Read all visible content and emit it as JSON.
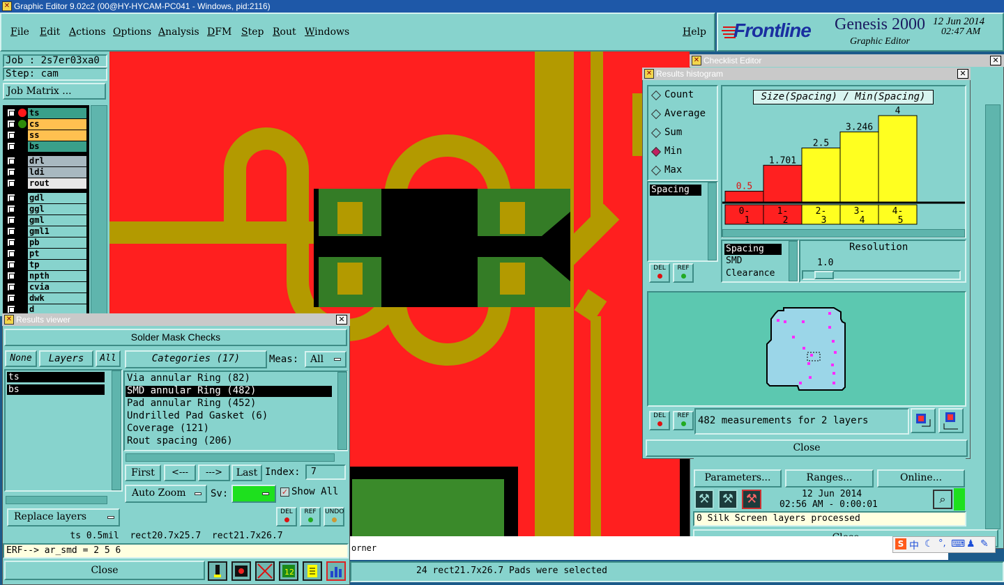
{
  "main_window": {
    "title": "Graphic Editor 9.02c2 (00@HY-HYCAM-PC041 - Windows, pid:2116)",
    "menu": [
      "File",
      "Edit",
      "Actions",
      "Options",
      "Analysis",
      "DFM",
      "Step",
      "Rout",
      "Windows"
    ],
    "help": "Help",
    "brand": "Frontline",
    "product": "Genesis 2000",
    "subtitle": "Graphic Editor",
    "date": "12 Jun 2014",
    "time": "02:47 AM"
  },
  "left_panel": {
    "job": "Job : 2s7er03xa0",
    "step": "Step: cam",
    "job_matrix": "Job Matrix ...",
    "layers": [
      {
        "name": "ts",
        "color": "#3aa08a",
        "dot": "#ff1a1a"
      },
      {
        "name": "cs",
        "color": "#ffc050",
        "dot": "#2e8b0a"
      },
      {
        "name": "ss",
        "color": "#ffc050",
        "dot": ""
      },
      {
        "name": "bs",
        "color": "#3aa08a",
        "dot": ""
      },
      {
        "name": "drl",
        "color": "#a8b8c0",
        "dot": ""
      },
      {
        "name": "ldi",
        "color": "#a8b8c0",
        "dot": ""
      },
      {
        "name": "rout",
        "color": "#e6e6e6",
        "dot": ""
      },
      {
        "name": "gdl",
        "color": "#87d3cd",
        "dot": ""
      },
      {
        "name": "ggl",
        "color": "#87d3cd",
        "dot": ""
      },
      {
        "name": "gml",
        "color": "#87d3cd",
        "dot": ""
      },
      {
        "name": "gml1",
        "color": "#87d3cd",
        "dot": ""
      },
      {
        "name": "pb",
        "color": "#87d3cd",
        "dot": ""
      },
      {
        "name": "pt",
        "color": "#87d3cd",
        "dot": ""
      },
      {
        "name": "tp",
        "color": "#87d3cd",
        "dot": ""
      },
      {
        "name": "npth",
        "color": "#87d3cd",
        "dot": ""
      },
      {
        "name": "cvia",
        "color": "#87d3cd",
        "dot": ""
      },
      {
        "name": "dwk",
        "color": "#87d3cd",
        "dot": ""
      },
      {
        "name": "d",
        "color": "#87d3cd",
        "dot": ""
      }
    ]
  },
  "results_viewer": {
    "title": "Results viewer",
    "header": "Solder Mask Checks",
    "none": "None",
    "layers_label": "Layers",
    "all": "All",
    "layer_list": [
      "ts",
      "bs"
    ],
    "categories": "Categories (17)",
    "meas_label": "Meas:",
    "meas_value": "All",
    "category_items": [
      "Via annular Ring (82)",
      "SMD annular Ring (482)",
      "Pad annular Ring (452)",
      "Undrilled Pad Gasket (6)",
      "Coverage (121)",
      "Rout spacing (206)"
    ],
    "first": "First",
    "prev": "<---",
    "next": "--->",
    "last": "Last",
    "index_label": "Index:",
    "index_value": "7",
    "auto_zoom": "Auto Zoom",
    "sv_label": "Sv:",
    "show_all": "Show All",
    "replace_layers": "Replace layers",
    "del": "DEL",
    "ref": "REF",
    "undo": "UNDO",
    "status_line": "ts 0.5mil  rect20.7x25.7  rect21.7x26.7",
    "erf_line": "ERF--> ar_smd = 2 5 6",
    "close": "Close"
  },
  "bottom_status": {
    "fragment": "orner",
    "message": "24 rect21.7x26.7 Pads were selected"
  },
  "checklist_editor": {
    "title": "Checklist Editor",
    "parameters": "Parameters...",
    "ranges": "Ranges...",
    "online": "Online...",
    "date": "12 Jun 2014",
    "time": "02:56 AM - 0:00:01",
    "status": "0 Silk Screen layers processed",
    "close": "Close"
  },
  "histogram": {
    "title": "Results histogram",
    "modes": [
      "Count",
      "Average",
      "Sum",
      "Min",
      "Max"
    ],
    "selected_mode": "Min",
    "chart_title": "Size(Spacing) / Min(Spacing)",
    "left_list": [
      "Spacing"
    ],
    "measure_list": [
      "Spacing",
      "SMD",
      "Clearance"
    ],
    "resolution_label": "Resolution",
    "resolution_value": "1.0",
    "summary": "482 measurements for 2 layers",
    "close": "Close",
    "del": "DEL",
    "ref": "REF"
  },
  "chart_data": {
    "type": "bar",
    "title": "Size(Spacing) / Min(Spacing)",
    "categories": [
      "0-1",
      "1-2",
      "2-3",
      "3-4",
      "4-5"
    ],
    "values": [
      0.5,
      1.701,
      2.5,
      3.246,
      4
    ],
    "labels": [
      "0.5",
      "1.701",
      "2.5",
      "3.246",
      "4"
    ],
    "colors": [
      "#ff2020",
      "#ff2020",
      "#ffff20",
      "#ffff20",
      "#ffff20"
    ],
    "ylim": [
      0,
      4
    ]
  },
  "tray": {
    "ime": "中"
  }
}
